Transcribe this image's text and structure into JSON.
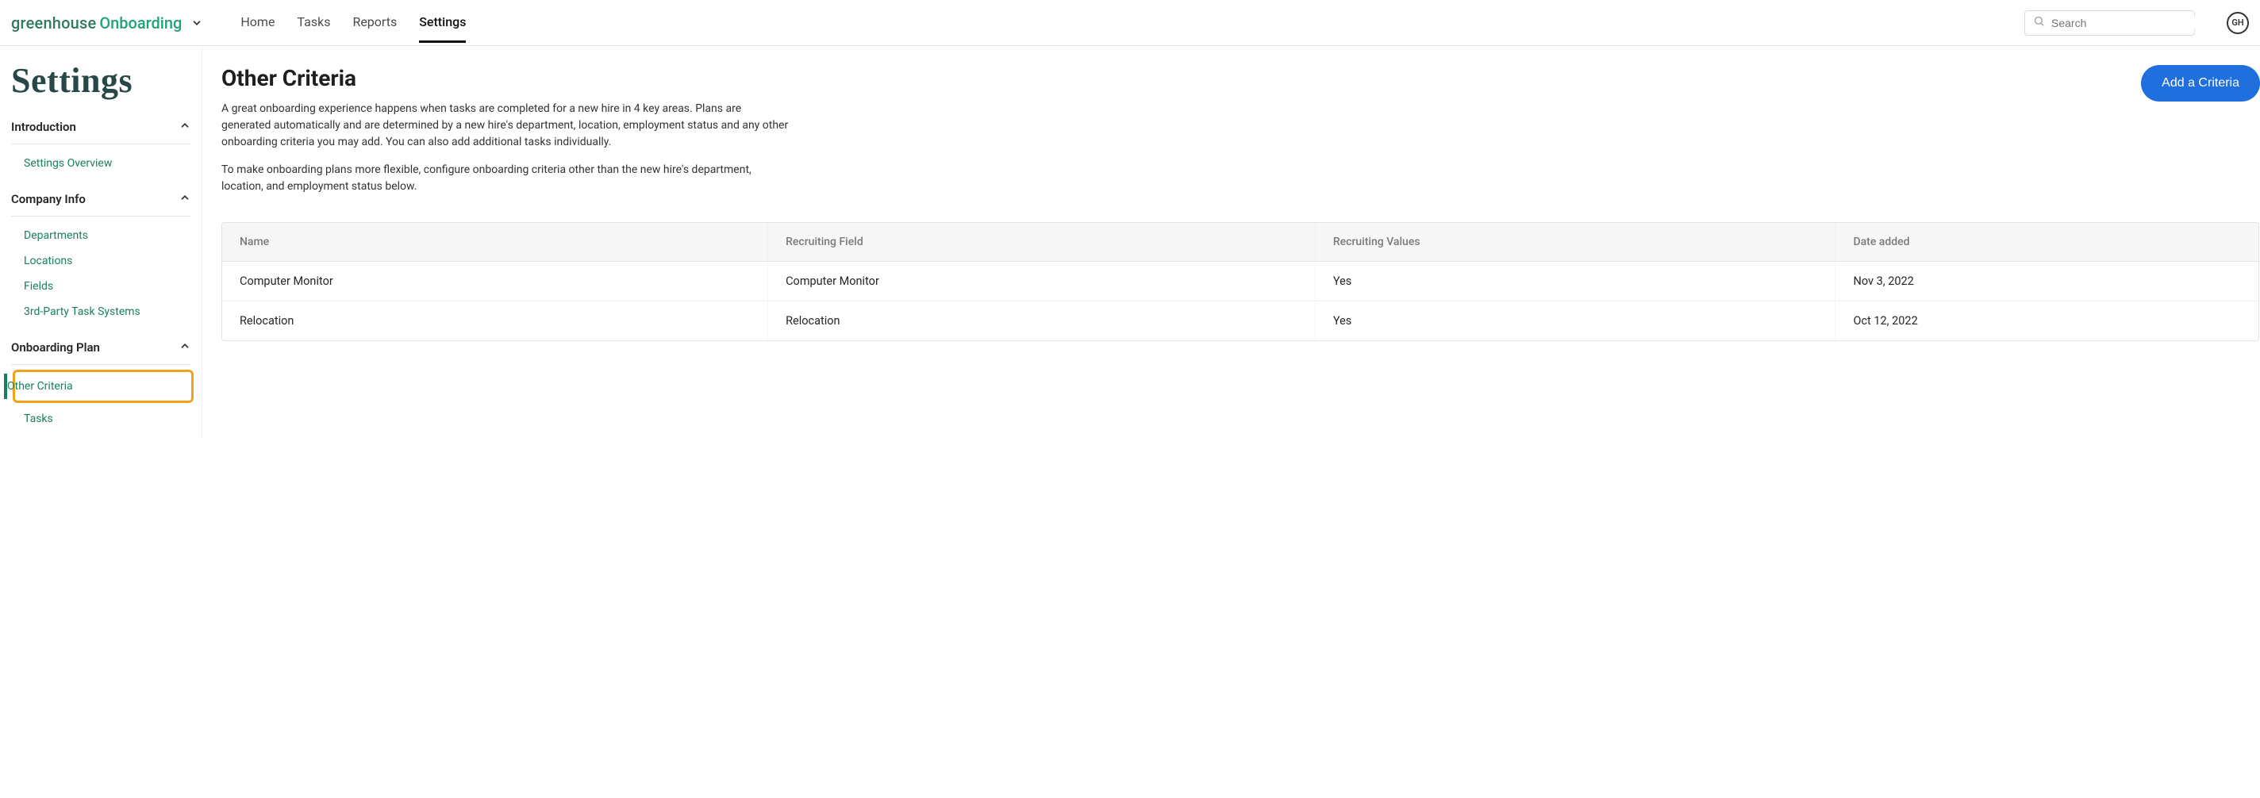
{
  "logo": {
    "main": "greenhouse",
    "sub": "Onboarding"
  },
  "nav": {
    "home": "Home",
    "tasks": "Tasks",
    "reports": "Reports",
    "settings": "Settings"
  },
  "search": {
    "placeholder": "Search"
  },
  "avatar": "GH",
  "page_title": "Settings",
  "sidebar": {
    "introduction": {
      "label": "Introduction",
      "items": {
        "overview": "Settings Overview"
      }
    },
    "company": {
      "label": "Company Info",
      "items": {
        "departments": "Departments",
        "locations": "Locations",
        "fields": "Fields",
        "third_party": "3rd-Party Task Systems"
      }
    },
    "onboarding": {
      "label": "Onboarding Plan",
      "items": {
        "other_criteria": "Other Criteria",
        "tasks": "Tasks"
      }
    }
  },
  "content": {
    "title": "Other Criteria",
    "add_button": "Add a Criteria",
    "p1": "A great onboarding experience happens when tasks are completed for a new hire in 4 key areas. Plans are generated automatically and are determined by a new hire's department, location, employment status and any other onboarding criteria you may add. You can also add additional tasks individually.",
    "p2": "To make onboarding plans more flexible, configure onboarding criteria other than the new hire's department, location, and employment status below."
  },
  "table": {
    "headers": {
      "name": "Name",
      "field": "Recruiting Field",
      "values": "Recruiting Values",
      "date": "Date added"
    },
    "rows": [
      {
        "name": "Computer Monitor",
        "field": "Computer Monitor",
        "values": "Yes",
        "date": "Nov 3, 2022"
      },
      {
        "name": "Relocation",
        "field": "Relocation",
        "values": "Yes",
        "date": "Oct 12, 2022"
      }
    ]
  }
}
